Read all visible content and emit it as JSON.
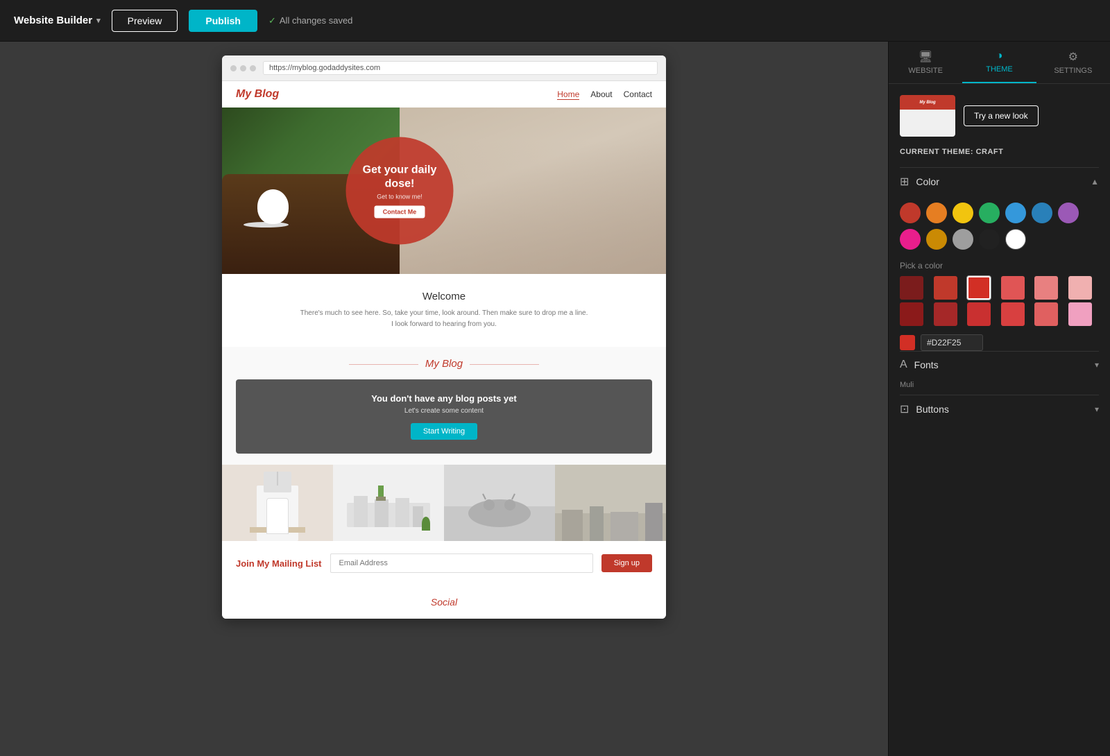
{
  "topbar": {
    "app_title": "Website Builder",
    "preview_label": "Preview",
    "publish_label": "Publish",
    "saved_status": "All changes saved"
  },
  "browser": {
    "url": "https://myblog.godaddysites.com"
  },
  "site": {
    "logo": "My Blog",
    "nav_links": [
      "Home",
      "About",
      "Contact"
    ],
    "nav_active": "Home",
    "hero_title": "Get your daily dose!",
    "hero_sub": "Get to know me!",
    "hero_cta": "Contact Me",
    "welcome_title": "Welcome",
    "welcome_text1": "There's much to see here. So, take your time, look around. Then make sure to drop me a line.",
    "welcome_text2": "I look forward to hearing from you.",
    "blog_section_title": "My Blog",
    "blog_empty_title": "You don't have any blog posts yet",
    "blog_empty_sub": "Let's create some content",
    "btn_start_writing": "Start Writing",
    "mailing_title": "Join My Mailing List",
    "mailing_placeholder": "Email Address",
    "btn_signup": "Sign up",
    "social_title": "Social"
  },
  "right_panel": {
    "tabs": [
      {
        "id": "website",
        "label": "WEBSITE",
        "icon": "🖥"
      },
      {
        "id": "theme",
        "label": "THEME",
        "icon": "◑"
      },
      {
        "id": "settings",
        "label": "SETTINGS",
        "icon": "⚙"
      }
    ],
    "active_tab": "theme",
    "btn_try_new_look": "Try a new look",
    "current_theme_label": "CURRENT THEME:",
    "current_theme_name": "CRAFT",
    "sections": {
      "color": {
        "label": "Color",
        "expanded": true,
        "swatches": [
          {
            "color": "#C0392B",
            "id": "red"
          },
          {
            "color": "#E67E22",
            "id": "orange"
          },
          {
            "color": "#F1C40F",
            "id": "yellow"
          },
          {
            "color": "#27AE60",
            "id": "green"
          },
          {
            "color": "#3498DB",
            "id": "blue"
          },
          {
            "color": "#2980B9",
            "id": "dark-blue"
          },
          {
            "color": "#9B59B6",
            "id": "purple"
          },
          {
            "color": "#E91E8C",
            "id": "pink"
          },
          {
            "color": "#CA8A04",
            "id": "tan"
          },
          {
            "color": "#9E9E9E",
            "id": "gray"
          },
          {
            "color": "#212121",
            "id": "black"
          },
          {
            "color": "#FFFFFF",
            "id": "white"
          }
        ],
        "pick_color_label": "Pick a color",
        "color_picker_swatches": [
          {
            "color": "#7B1C1C"
          },
          {
            "color": "#C0392B"
          },
          {
            "color": "#D22F25",
            "selected": true
          },
          {
            "color": "#E05555"
          },
          {
            "color": "#E88080"
          },
          {
            "color": "#F0B0B0"
          },
          {
            "color": "#8B1A1A"
          },
          {
            "color": "#A52828"
          },
          {
            "color": "#C93030"
          },
          {
            "color": "#D84040"
          },
          {
            "color": "#E06060"
          },
          {
            "color": "#F0A0C0"
          }
        ],
        "hex_value": "#D22F25"
      },
      "fonts": {
        "label": "Fonts",
        "sub_label": "Muli",
        "expanded": false
      },
      "buttons": {
        "label": "Buttons",
        "expanded": false
      }
    }
  }
}
